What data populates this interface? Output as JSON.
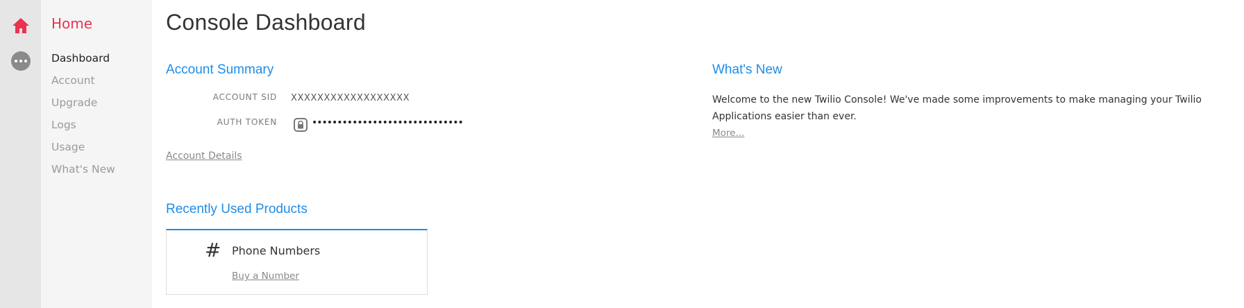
{
  "rail": {
    "home_icon": "home-icon",
    "more_icon": "more-icon",
    "accent_color": "#e8344e"
  },
  "subnav": {
    "title": "Home",
    "items": [
      {
        "label": "Dashboard",
        "active": true
      },
      {
        "label": "Account",
        "active": false
      },
      {
        "label": "Upgrade",
        "active": false
      },
      {
        "label": "Logs",
        "active": false
      },
      {
        "label": "Usage",
        "active": false
      },
      {
        "label": "What's New",
        "active": false
      }
    ]
  },
  "page": {
    "title": "Console Dashboard"
  },
  "account_summary": {
    "heading": "Account Summary",
    "sid_label": "ACCOUNT SID",
    "sid_value": "XXXXXXXXXXXXXXXXXX",
    "token_label": "AUTH TOKEN",
    "token_masked": "••••••••••••••••••••••••••••••",
    "details_link": "Account Details"
  },
  "recent_products": {
    "heading": "Recently Used Products",
    "items": [
      {
        "icon": "hash-icon",
        "name": "Phone Numbers",
        "action": "Buy a Number"
      }
    ]
  },
  "whats_new": {
    "heading": "What's New",
    "text": "Welcome to the new Twilio Console! We've made some improvements to make managing your Twilio Applications easier than ever.",
    "more_link": "More..."
  },
  "colors": {
    "link_blue": "#1f8ce6",
    "rail_bg": "#e6e6e6",
    "subnav_bg": "#f5f5f5"
  }
}
